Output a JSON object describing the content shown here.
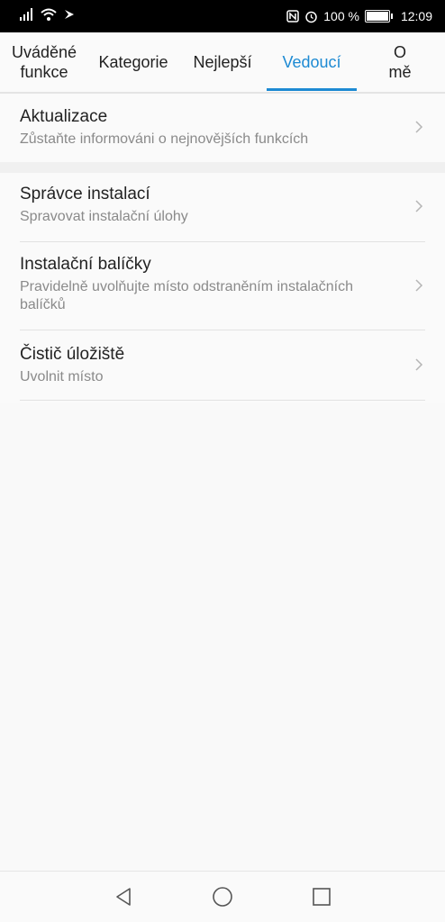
{
  "status_bar": {
    "battery": "100 %",
    "time": "12:09"
  },
  "tabs": [
    {
      "label": "Uváděné\nfunkce"
    },
    {
      "label": "Kategorie"
    },
    {
      "label": "Nejlepší"
    },
    {
      "label": "Vedoucí"
    },
    {
      "label": "O\nmě"
    }
  ],
  "active_tab": "Vedoucí",
  "accent_color": "#1d8ad3",
  "list": {
    "updates": {
      "title": "Aktualizace",
      "subtitle": "Zůstaňte informováni o nejnovějších funkcích"
    },
    "install_manager": {
      "title": "Správce instalací",
      "subtitle": "Spravovat instalační úlohy"
    },
    "install_packages": {
      "title": "Instalační balíčky",
      "subtitle": "Pravidelně uvolňujte místo odstraněním instalačních balíčků"
    },
    "storage_cleaner": {
      "title": "Čistič úložiště",
      "subtitle": "Uvolnit místo"
    }
  }
}
